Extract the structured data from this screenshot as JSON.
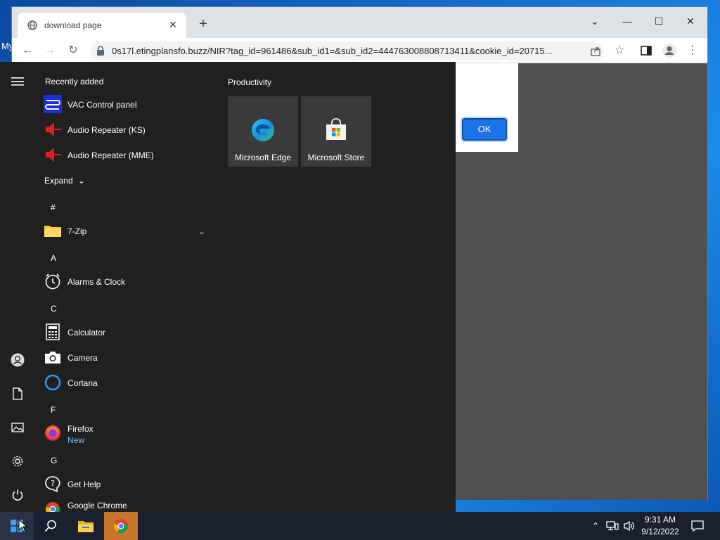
{
  "desktop": {
    "label": "My"
  },
  "browser": {
    "tab_title": "download page",
    "url": "0s17l.etingplansfo.buzz/NIR?tag_id=961486&sub_id1=&sub_id2=444763008808713411&cookie_id=20715...",
    "dialog_ok": "OK"
  },
  "start_menu": {
    "recently_added": "Recently added",
    "recent_apps": [
      {
        "label": "VAC Control panel"
      },
      {
        "label": "Audio Repeater (KS)"
      },
      {
        "label": "Audio Repeater (MME)"
      }
    ],
    "expand": "Expand",
    "letters": {
      "hash": "#",
      "a": "A",
      "c": "C",
      "f": "F",
      "g": "G"
    },
    "apps": {
      "zip": "7-Zip",
      "alarms": "Alarms & Clock",
      "calculator": "Calculator",
      "camera": "Camera",
      "cortana": "Cortana",
      "firefox": "Firefox",
      "firefox_sub": "New",
      "get_help": "Get Help",
      "chrome": "Google Chrome"
    },
    "group_title": "Productivity",
    "tiles": [
      {
        "label": "Microsoft Edge"
      },
      {
        "label": "Microsoft Store"
      }
    ]
  },
  "taskbar": {
    "time": "9:31 AM",
    "date": "9/12/2022"
  },
  "colors": {
    "start_bg": "#202020",
    "taskbar_bg": "#1b2030",
    "ok_button": "#1a73e8",
    "accent_sub": "#7db9ff"
  }
}
